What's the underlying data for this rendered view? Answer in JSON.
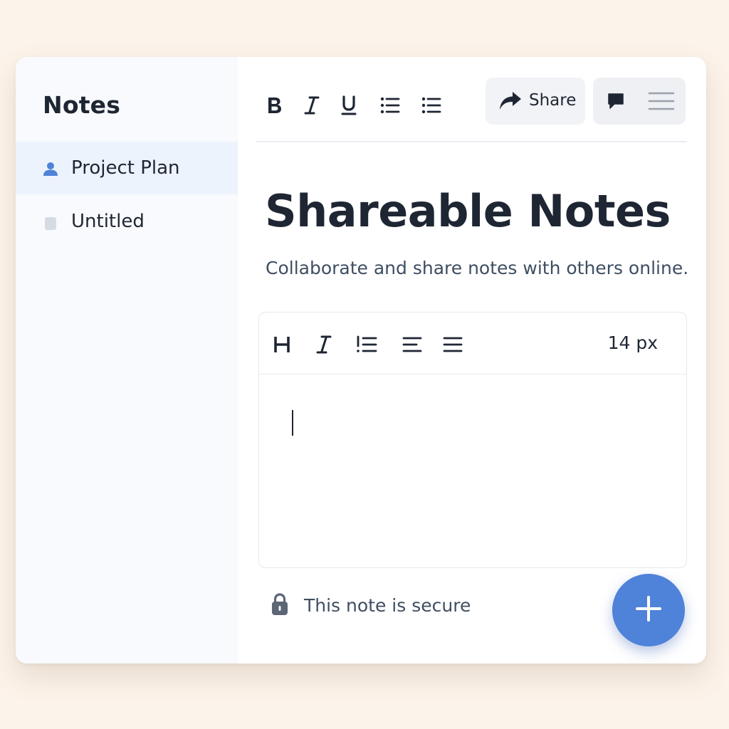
{
  "sidebar": {
    "title": "Notes",
    "items": [
      {
        "label": "Project Plan",
        "icon": "person-icon",
        "active": true
      },
      {
        "label": "Untitled",
        "icon": "document-icon",
        "active": false
      }
    ]
  },
  "toolbar": {
    "buttons": [
      "bold-icon",
      "italic-icon",
      "underline-icon",
      "bulleted-list-icon",
      "bulleted-list-icon"
    ],
    "share_label": "Share",
    "extra_buttons": [
      "comment-icon",
      "menu-icon"
    ]
  },
  "main": {
    "title": "Shareable Notes",
    "subtitle": "Collaborate and share notes with others online."
  },
  "editor": {
    "toolbar_buttons": [
      "heading-icon",
      "italic-icon",
      "numbered-list-icon",
      "align-left-icon",
      "align-justify-icon"
    ],
    "font_size": "14 px",
    "content": ""
  },
  "footer": {
    "secure_text": "This note is secure"
  },
  "colors": {
    "accent": "#4f82d9",
    "background": "#fcf3ea",
    "sidebar_bg": "#f8fafd",
    "active_item_bg": "#edf3fd",
    "text_primary": "#1f2633",
    "text_secondary": "#3f4e62"
  }
}
